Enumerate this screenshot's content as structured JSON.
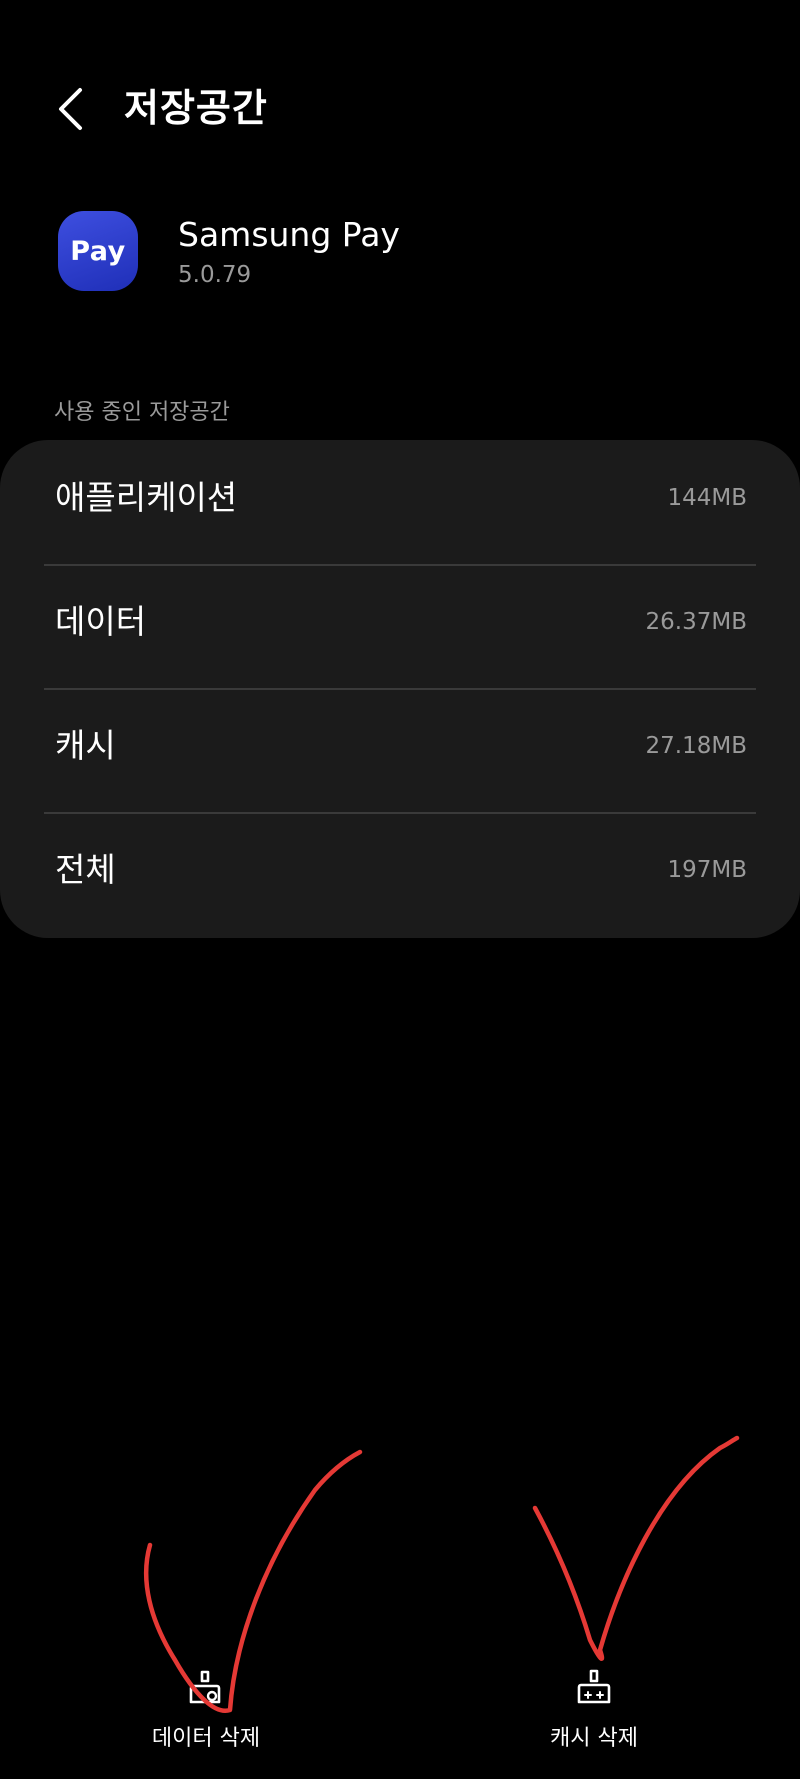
{
  "header": {
    "title": "저장공간",
    "back_icon": "chevron-left-icon"
  },
  "app": {
    "icon_text": "Pay",
    "name": "Samsung Pay",
    "version": "5.0.79",
    "icon_color": "#2a39d0"
  },
  "section": {
    "label": "사용 중인 저장공간"
  },
  "storage": [
    {
      "label": "애플리케이션",
      "value": "144MB"
    },
    {
      "label": "데이터",
      "value": "26.37MB"
    },
    {
      "label": "캐시",
      "value": "27.18MB"
    },
    {
      "label": "전체",
      "value": "197MB"
    }
  ],
  "actions": {
    "clear_data": {
      "label": "데이터 삭제",
      "icon": "broom-icon"
    },
    "clear_cache": {
      "label": "캐시 삭제",
      "icon": "broom-sparkle-icon"
    }
  },
  "colors": {
    "background": "#000000",
    "card": "#1b1b1b",
    "secondary_text": "#9a9a9a",
    "annotation": "#e53935"
  }
}
